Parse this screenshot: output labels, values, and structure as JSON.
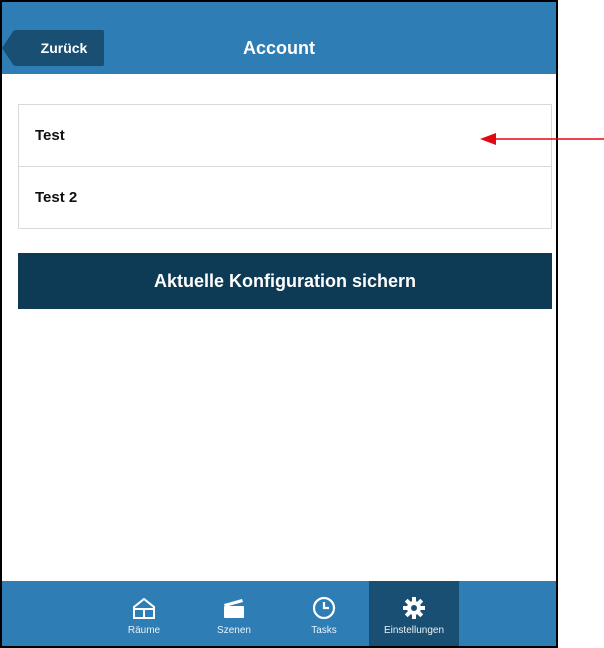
{
  "header": {
    "back_label": "Zurück",
    "title": "Account"
  },
  "accounts": [
    {
      "label": "Test"
    },
    {
      "label": "Test 2"
    }
  ],
  "actions": {
    "save_label": "Aktuelle Konfiguration sichern"
  },
  "tabbar": {
    "tabs": [
      {
        "label": "Räume",
        "icon": "house-icon"
      },
      {
        "label": "Szenen",
        "icon": "clapperboard-icon"
      },
      {
        "label": "Tasks",
        "icon": "clock-icon"
      },
      {
        "label": "Einstellungen",
        "icon": "settings-icon",
        "active": true
      }
    ]
  },
  "colors": {
    "header": "#2f7db5",
    "header_dark": "#184f72",
    "primary_button": "#0d3a55",
    "annotation_arrow": "#e30613"
  }
}
